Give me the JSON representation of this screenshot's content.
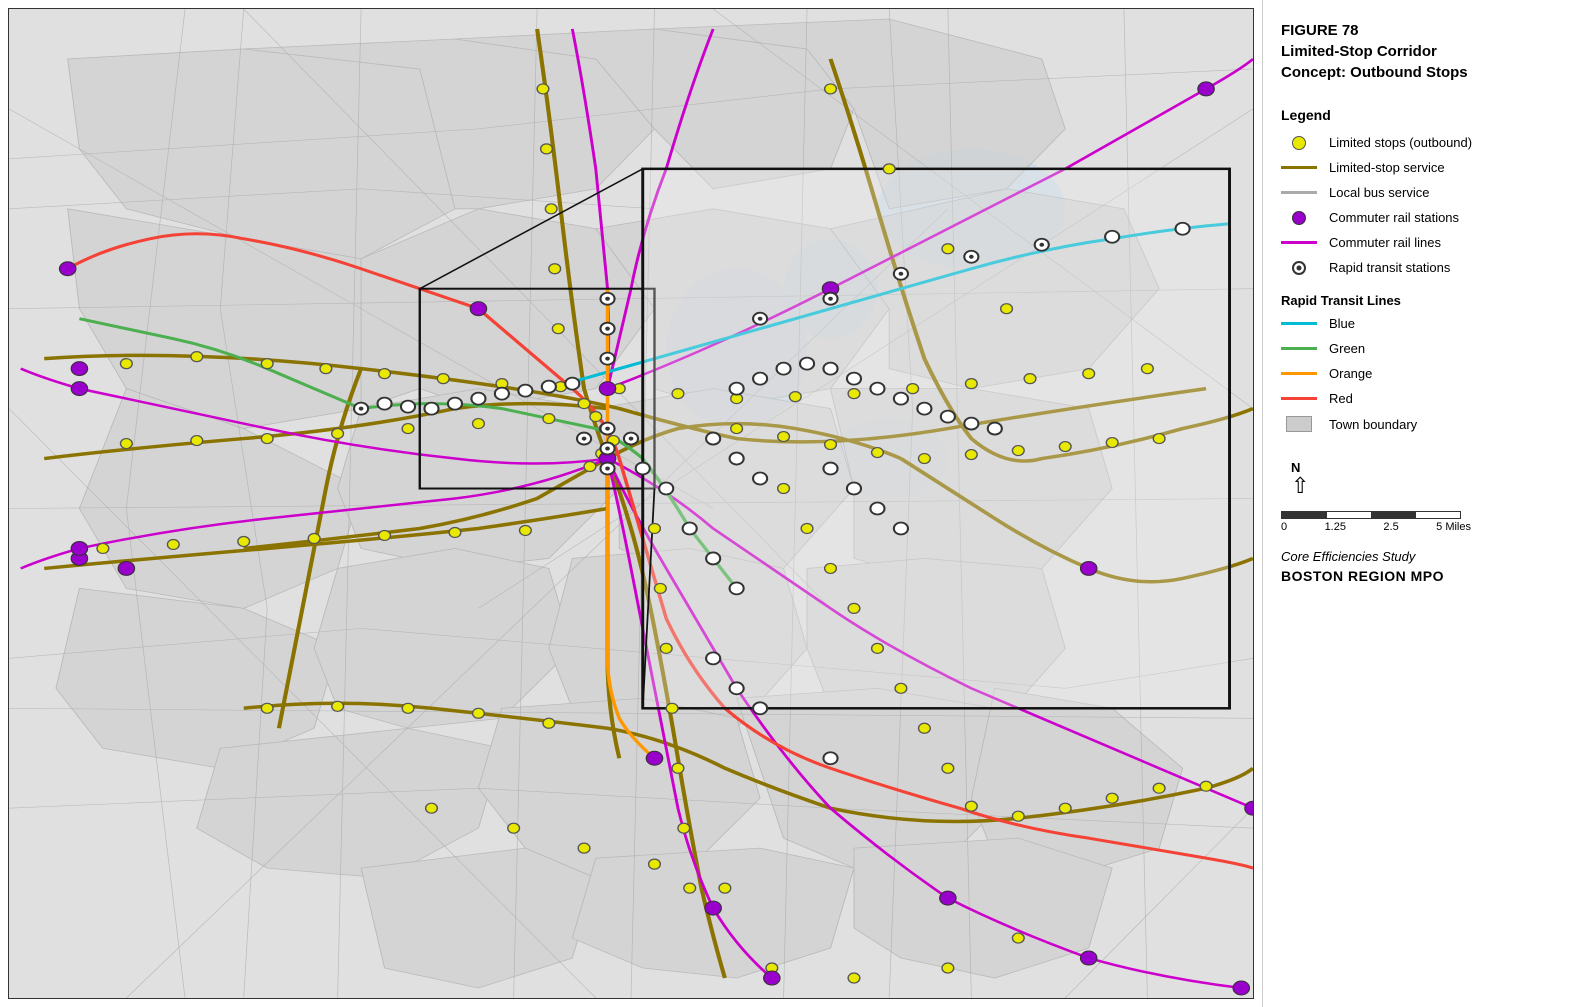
{
  "figure": {
    "number": "FIGURE 78",
    "title_line1": "Limited-Stop Corridor",
    "title_line2": "Concept: Outbound Stops"
  },
  "legend": {
    "title": "Legend",
    "items": [
      {
        "id": "limited-stops",
        "symbol": "yellow-circle",
        "label": "Limited stops (outbound)"
      },
      {
        "id": "limited-stop-service",
        "symbol": "dark-yellow-line",
        "label": "Limited-stop service"
      },
      {
        "id": "local-bus",
        "symbol": "gray-line",
        "label": "Local bus service"
      },
      {
        "id": "commuter-rail-stations",
        "symbol": "purple-circle",
        "label": "Commuter rail stations"
      },
      {
        "id": "commuter-rail-lines",
        "symbol": "magenta-line",
        "label": "Commuter rail lines"
      },
      {
        "id": "rapid-transit-stations",
        "symbol": "open-circle",
        "label": "Rapid transit stations"
      }
    ],
    "rapid_transit_title": "Rapid Transit Lines",
    "rapid_transit_lines": [
      {
        "id": "blue",
        "color": "#00bcd4",
        "label": "Blue"
      },
      {
        "id": "green",
        "color": "#4caf50",
        "label": "Green"
      },
      {
        "id": "orange",
        "color": "#ff9800",
        "label": "Orange"
      },
      {
        "id": "red",
        "color": "#f44336",
        "label": "Red"
      }
    ],
    "town_boundary_label": "Town boundary"
  },
  "scale": {
    "labels": [
      "0",
      "1.25",
      "2.5",
      "",
      "5 Miles"
    ]
  },
  "footer": {
    "study": "Core Efficiencies Study",
    "org": "BOSTON REGION MPO"
  }
}
